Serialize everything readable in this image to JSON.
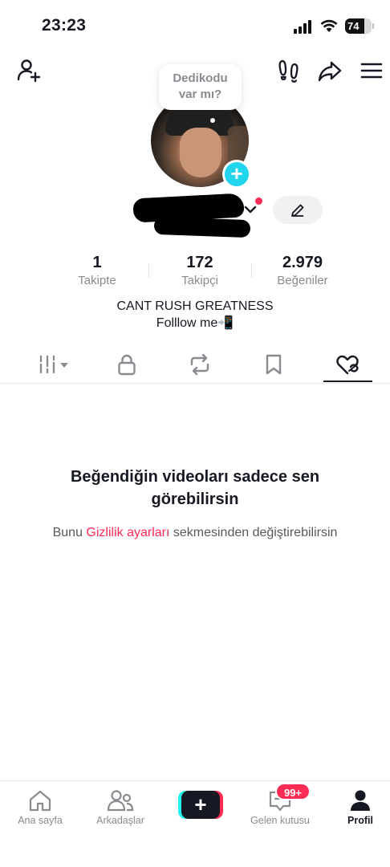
{
  "status_bar": {
    "time": "23:23",
    "battery": "74",
    "battery_level": 0.74
  },
  "top_nav": {
    "add_friend_icon": "person-add-icon",
    "footprints_icon": "footprints-icon",
    "share_icon": "share-icon",
    "menu_icon": "menu-icon"
  },
  "profile": {
    "bubble_line1": "Dedikodu",
    "bubble_line2": "var mı?",
    "avatar_add": "+",
    "username": "",
    "stats": [
      {
        "value": "1",
        "label": "Takipte"
      },
      {
        "value": "172",
        "label": "Takipçi"
      },
      {
        "value": "2.979",
        "label": "Beğeniler"
      }
    ],
    "bio_line1": "CANT RUSH GREATNESS",
    "bio_line2": "Folllow me📲"
  },
  "tabs": {
    "items": [
      "videos-grid-icon",
      "lock-icon",
      "repost-icon",
      "bookmark-icon",
      "liked-icon"
    ],
    "active": "liked-icon"
  },
  "empty_state": {
    "title_line1": "Beğendiğin videoları sadece sen",
    "title_line2": "görebilirsin",
    "sub_prefix": "Bunu ",
    "sub_link": "Gizlilik ayarları",
    "sub_suffix": " sekmesinden değiştirebilirsin"
  },
  "bottom_nav": {
    "items": [
      {
        "label": "Ana sayfa",
        "icon": "home-icon"
      },
      {
        "label": "Arkadaşlar",
        "icon": "friends-icon"
      },
      {
        "label": "+",
        "icon": "create-icon"
      },
      {
        "label": "Gelen kutusu",
        "icon": "inbox-icon"
      },
      {
        "label": "Profil",
        "icon": "profile-icon"
      }
    ],
    "inbox_badge": "99+",
    "active": "Profil"
  },
  "colors": {
    "accent": "#fe2c55",
    "cyan": "#25f4ee",
    "avatar_add": "#20d5ec",
    "text": "#161823",
    "muted": "#8a8b91"
  }
}
